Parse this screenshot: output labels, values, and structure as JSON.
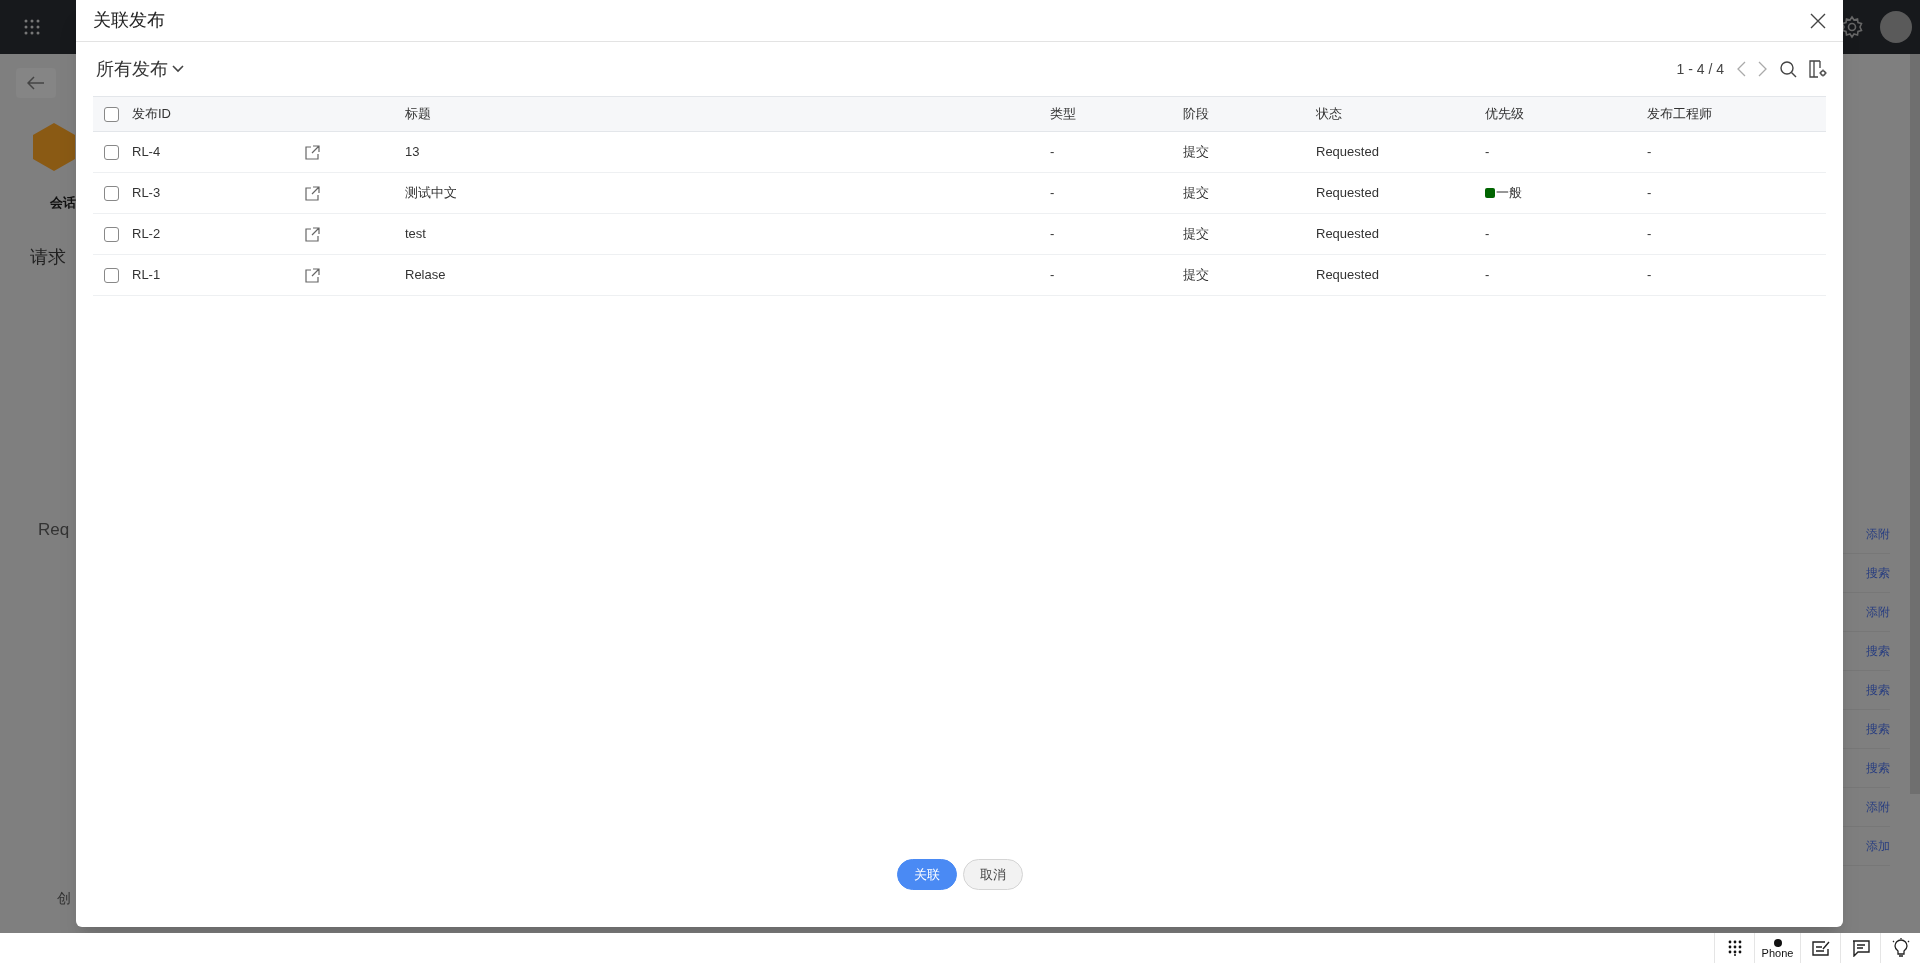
{
  "background": {
    "left_labels": [
      {
        "text": "会话",
        "kind": "tab"
      },
      {
        "text": "请求",
        "kind": "heading"
      },
      {
        "text": "Req",
        "kind": "value"
      },
      {
        "text": "创",
        "kind": "field"
      }
    ],
    "right_links": [
      "添附",
      "搜索",
      "添附",
      "搜索",
      "搜索",
      "搜索",
      "搜索",
      "添附",
      "添加"
    ]
  },
  "dialog": {
    "title": "关联发布",
    "view_selector": "所有发布",
    "pagination": "1 - 4 / 4",
    "all_selected": false,
    "columns": [
      "发布ID",
      "标题",
      "类型",
      "阶段",
      "状态",
      "优先级",
      "发布工程师"
    ],
    "rows": [
      {
        "selected": false,
        "id": "RL-4",
        "title": "13",
        "type": "-",
        "stage": "提交",
        "status": "Requested",
        "priority": {
          "text": "-"
        },
        "engineer": "-"
      },
      {
        "selected": false,
        "id": "RL-3",
        "title": "测试中文",
        "type": "-",
        "stage": "提交",
        "status": "Requested",
        "priority": {
          "text": "一般",
          "color": "#006400"
        },
        "engineer": "-"
      },
      {
        "selected": false,
        "id": "RL-2",
        "title": "test",
        "type": "-",
        "stage": "提交",
        "status": "Requested",
        "priority": {
          "text": "-"
        },
        "engineer": "-"
      },
      {
        "selected": false,
        "id": "RL-1",
        "title": "Relase",
        "type": "-",
        "stage": "提交",
        "status": "Requested",
        "priority": {
          "text": "-"
        },
        "engineer": "-"
      }
    ],
    "buttons": [
      {
        "label": "关联",
        "kind": "primary"
      },
      {
        "label": "取消",
        "kind": "secondary"
      }
    ]
  },
  "taskbar": {
    "phone_label": "Phone"
  }
}
